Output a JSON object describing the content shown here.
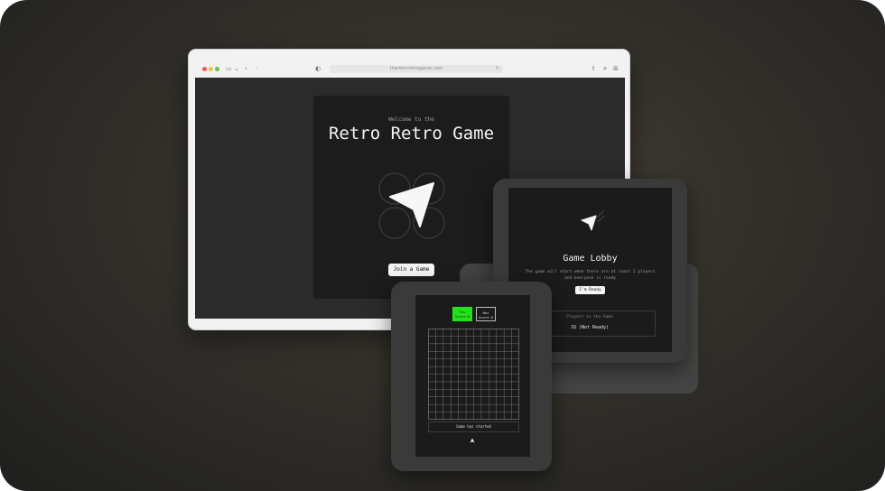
{
  "browser": {
    "url": "theretroretrogame.com",
    "glyphs": {
      "sidebar": "▭",
      "chevron": "⌄",
      "back": "‹",
      "forward": "›",
      "shield": "◐",
      "share": "⇪",
      "new_tab": "+",
      "tabs": "⊞",
      "reload": "↻"
    }
  },
  "welcome": {
    "subtitle": "Welcome to the",
    "title": "Retro Retro Game",
    "join_label": "Join a Game"
  },
  "lobby": {
    "title": "Game Lobby",
    "description": "The game will start when there are at least 2 players and everyone is ready",
    "ready_label": "I'm Ready",
    "players_heading": "Players in the Game",
    "players": [
      "JQ (Not Ready)"
    ]
  },
  "game": {
    "scores": [
      {
        "name": "You",
        "score_label": "Score:0",
        "color": "#22e31a"
      },
      {
        "name": "Bot",
        "score_label": "Score:0",
        "color": "#1b1b1b"
      }
    ],
    "grid_size": 12,
    "status": "Game has started"
  },
  "colors": {
    "player_green": "#22e31a",
    "card_dark": "#1c1c1c",
    "device_frame": "#3a3a3a"
  }
}
